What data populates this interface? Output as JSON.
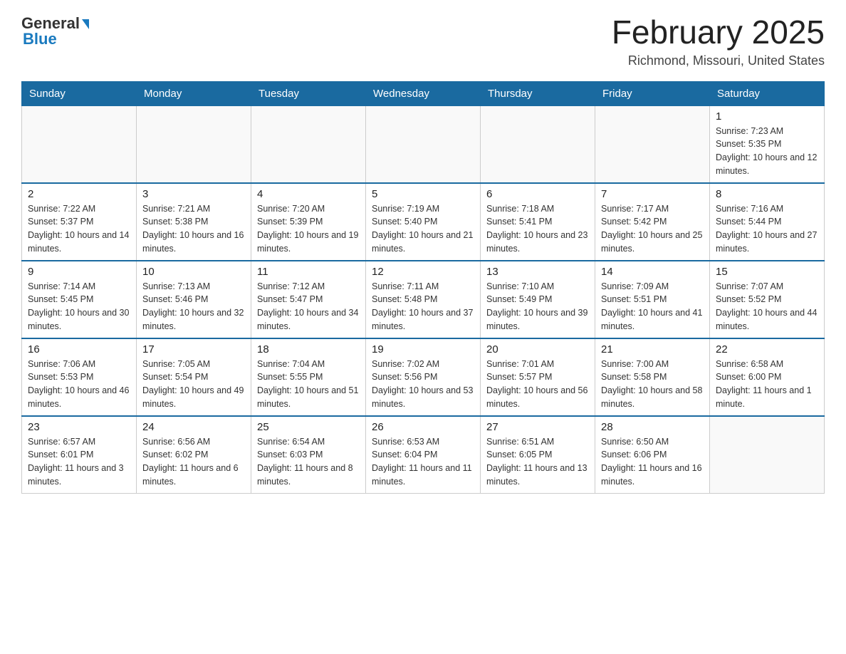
{
  "header": {
    "logo_general": "General",
    "logo_blue": "Blue",
    "month_title": "February 2025",
    "location": "Richmond, Missouri, United States"
  },
  "days_of_week": [
    "Sunday",
    "Monday",
    "Tuesday",
    "Wednesday",
    "Thursday",
    "Friday",
    "Saturday"
  ],
  "weeks": [
    [
      {
        "date": "",
        "info": ""
      },
      {
        "date": "",
        "info": ""
      },
      {
        "date": "",
        "info": ""
      },
      {
        "date": "",
        "info": ""
      },
      {
        "date": "",
        "info": ""
      },
      {
        "date": "",
        "info": ""
      },
      {
        "date": "1",
        "info": "Sunrise: 7:23 AM\nSunset: 5:35 PM\nDaylight: 10 hours and 12 minutes."
      }
    ],
    [
      {
        "date": "2",
        "info": "Sunrise: 7:22 AM\nSunset: 5:37 PM\nDaylight: 10 hours and 14 minutes."
      },
      {
        "date": "3",
        "info": "Sunrise: 7:21 AM\nSunset: 5:38 PM\nDaylight: 10 hours and 16 minutes."
      },
      {
        "date": "4",
        "info": "Sunrise: 7:20 AM\nSunset: 5:39 PM\nDaylight: 10 hours and 19 minutes."
      },
      {
        "date": "5",
        "info": "Sunrise: 7:19 AM\nSunset: 5:40 PM\nDaylight: 10 hours and 21 minutes."
      },
      {
        "date": "6",
        "info": "Sunrise: 7:18 AM\nSunset: 5:41 PM\nDaylight: 10 hours and 23 minutes."
      },
      {
        "date": "7",
        "info": "Sunrise: 7:17 AM\nSunset: 5:42 PM\nDaylight: 10 hours and 25 minutes."
      },
      {
        "date": "8",
        "info": "Sunrise: 7:16 AM\nSunset: 5:44 PM\nDaylight: 10 hours and 27 minutes."
      }
    ],
    [
      {
        "date": "9",
        "info": "Sunrise: 7:14 AM\nSunset: 5:45 PM\nDaylight: 10 hours and 30 minutes."
      },
      {
        "date": "10",
        "info": "Sunrise: 7:13 AM\nSunset: 5:46 PM\nDaylight: 10 hours and 32 minutes."
      },
      {
        "date": "11",
        "info": "Sunrise: 7:12 AM\nSunset: 5:47 PM\nDaylight: 10 hours and 34 minutes."
      },
      {
        "date": "12",
        "info": "Sunrise: 7:11 AM\nSunset: 5:48 PM\nDaylight: 10 hours and 37 minutes."
      },
      {
        "date": "13",
        "info": "Sunrise: 7:10 AM\nSunset: 5:49 PM\nDaylight: 10 hours and 39 minutes."
      },
      {
        "date": "14",
        "info": "Sunrise: 7:09 AM\nSunset: 5:51 PM\nDaylight: 10 hours and 41 minutes."
      },
      {
        "date": "15",
        "info": "Sunrise: 7:07 AM\nSunset: 5:52 PM\nDaylight: 10 hours and 44 minutes."
      }
    ],
    [
      {
        "date": "16",
        "info": "Sunrise: 7:06 AM\nSunset: 5:53 PM\nDaylight: 10 hours and 46 minutes."
      },
      {
        "date": "17",
        "info": "Sunrise: 7:05 AM\nSunset: 5:54 PM\nDaylight: 10 hours and 49 minutes."
      },
      {
        "date": "18",
        "info": "Sunrise: 7:04 AM\nSunset: 5:55 PM\nDaylight: 10 hours and 51 minutes."
      },
      {
        "date": "19",
        "info": "Sunrise: 7:02 AM\nSunset: 5:56 PM\nDaylight: 10 hours and 53 minutes."
      },
      {
        "date": "20",
        "info": "Sunrise: 7:01 AM\nSunset: 5:57 PM\nDaylight: 10 hours and 56 minutes."
      },
      {
        "date": "21",
        "info": "Sunrise: 7:00 AM\nSunset: 5:58 PM\nDaylight: 10 hours and 58 minutes."
      },
      {
        "date": "22",
        "info": "Sunrise: 6:58 AM\nSunset: 6:00 PM\nDaylight: 11 hours and 1 minute."
      }
    ],
    [
      {
        "date": "23",
        "info": "Sunrise: 6:57 AM\nSunset: 6:01 PM\nDaylight: 11 hours and 3 minutes."
      },
      {
        "date": "24",
        "info": "Sunrise: 6:56 AM\nSunset: 6:02 PM\nDaylight: 11 hours and 6 minutes."
      },
      {
        "date": "25",
        "info": "Sunrise: 6:54 AM\nSunset: 6:03 PM\nDaylight: 11 hours and 8 minutes."
      },
      {
        "date": "26",
        "info": "Sunrise: 6:53 AM\nSunset: 6:04 PM\nDaylight: 11 hours and 11 minutes."
      },
      {
        "date": "27",
        "info": "Sunrise: 6:51 AM\nSunset: 6:05 PM\nDaylight: 11 hours and 13 minutes."
      },
      {
        "date": "28",
        "info": "Sunrise: 6:50 AM\nSunset: 6:06 PM\nDaylight: 11 hours and 16 minutes."
      },
      {
        "date": "",
        "info": ""
      }
    ]
  ]
}
